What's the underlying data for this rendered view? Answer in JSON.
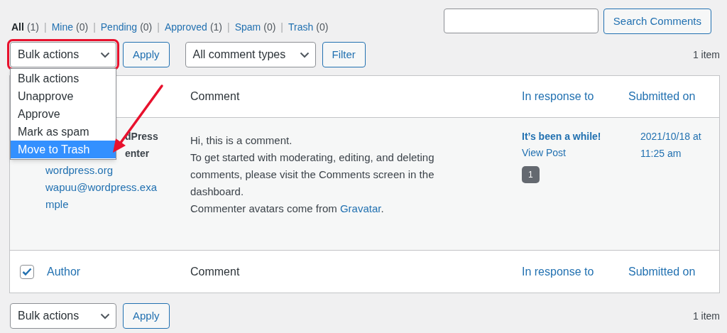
{
  "filters": [
    {
      "label": "All",
      "count": "(1)",
      "selected": true
    },
    {
      "separator": "|",
      "label": "Mine",
      "count": "(0)",
      "selected": false
    },
    {
      "separator": "|",
      "label": "Pending",
      "count": "(0)",
      "selected": false
    },
    {
      "separator": "|",
      "label": "Approved",
      "count": "(1)",
      "selected": false
    },
    {
      "separator": "|",
      "label": "Spam",
      "count": "(0)",
      "selected": false
    },
    {
      "separator": "|",
      "label": "Trash",
      "count": "(0)",
      "selected": false
    }
  ],
  "search": {
    "button": "Search Comments"
  },
  "top_bar": {
    "bulk_select": {
      "value": "Bulk actions",
      "highlighted": true
    },
    "apply": "Apply",
    "type_select": "All comment types",
    "filter": "Filter",
    "count": "1 item"
  },
  "bulk_menu": {
    "items": [
      {
        "label": "Bulk actions",
        "selected": false
      },
      {
        "label": "Unapprove",
        "selected": false
      },
      {
        "label": "Approve",
        "selected": false
      },
      {
        "label": "Mark as spam",
        "selected": false
      },
      {
        "label": "Move to Trash",
        "selected": true
      }
    ]
  },
  "table": {
    "header": {
      "columns": [
        "Comment",
        "In response to",
        "Submitted on"
      ]
    },
    "rows": [
      {
        "author_lines": [
          "dPress",
          "enter"
        ],
        "author_links": [
          "wordpress.org",
          "wapuu@wordpress.example"
        ],
        "comment": [
          [
            {
              "text": "Hi, this is a comment.",
              "link": false
            }
          ],
          [
            {
              "text": "To get started with moderating, editing, and deleting comments, please visit the Comments screen in the dashboard.",
              "link": false
            }
          ],
          [
            {
              "text": "Commenter avatars come from",
              "link": false
            },
            {
              "text": "Gravatar",
              "link": true
            },
            {
              "text": ".",
              "link": false
            }
          ]
        ],
        "post": "It’s been a while!",
        "view": "View Post",
        "comment_count": "1",
        "submitted": "2021/10/18 at 11:25 am"
      }
    ],
    "footer": {
      "checked": true,
      "columns": [
        "Author",
        "Comment",
        "In response to",
        "Submitted on"
      ]
    }
  },
  "bottom_bar": {
    "bulk_select": "Bulk actions",
    "apply": "Apply",
    "count": "1 item"
  }
}
